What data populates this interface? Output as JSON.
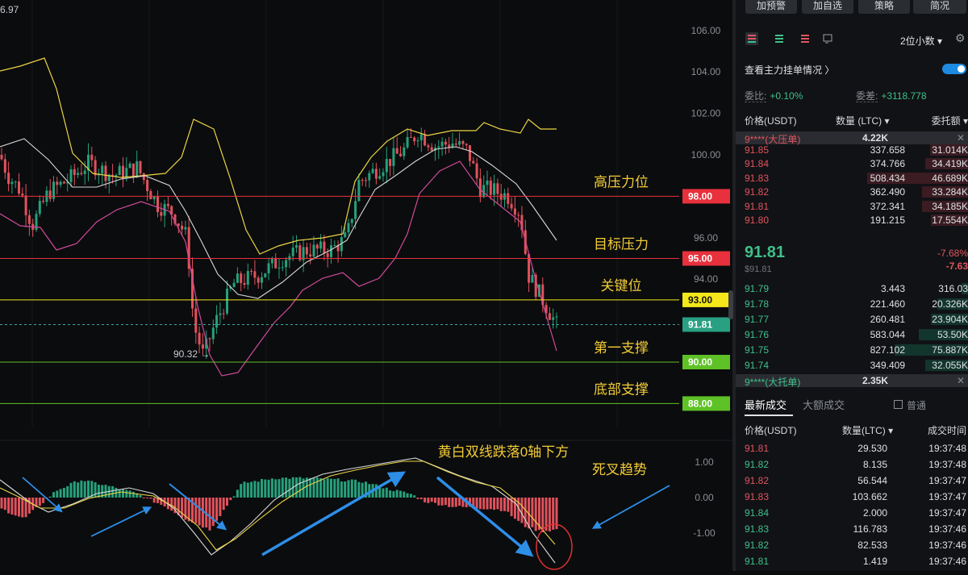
{
  "chart": {
    "price_axis_labels": [
      "106.00",
      "104.00",
      "102.00",
      "100.00",
      "96.00",
      "94.00"
    ],
    "corner_value": "6.97",
    "low_marker": "90.32",
    "levels": [
      {
        "name": "高压力位",
        "price": "98.00",
        "color": "#e8313c",
        "text_color": "#ffffff",
        "line": "#e8313c"
      },
      {
        "name": "目标压力",
        "price": "95.00",
        "color": "#e8313c",
        "text_color": "#ffffff",
        "line": "#e8313c"
      },
      {
        "name": "关键位",
        "price": "93.00",
        "color": "#f4e71a",
        "text_color": "#111111",
        "line": "#f4e71a"
      },
      {
        "name": "",
        "price": "91.81",
        "color": "#29a082",
        "text_color": "#ffffff",
        "line": "#3aa6a0"
      },
      {
        "name": "第一支撑",
        "price": "90.00",
        "color": "#5ec227",
        "text_color": "#ffffff",
        "line": "#5ec227"
      },
      {
        "name": "底部支撑",
        "price": "88.00",
        "color": "#5ec227",
        "text_color": "#ffffff",
        "line": "#5ec227"
      }
    ],
    "macd_axis_labels": [
      "1.00",
      "0.00",
      "-1.00"
    ],
    "annotations": {
      "cross_down": "黄白双线跌落0轴下方",
      "death_cross": "死叉趋势"
    },
    "colors": {
      "up": "#26a17b",
      "down": "#e0525c",
      "yellow": "#ecd545",
      "white": "#d8d8d8",
      "magenta": "#d04a9a",
      "arrow": "#2d8ee8",
      "label": "#f2cc36"
    }
  },
  "panel": {
    "buttons": [
      "加预警",
      "加自选",
      "策略",
      "简况"
    ],
    "decimals": "2位小数 ▾",
    "gear": "⚙",
    "check_label": "查看主力挂单情况",
    "ratio": {
      "k1": "委比:",
      "v1": "+0.10%",
      "k2": "委差:",
      "v2": "+3118.778"
    },
    "ob_headers": {
      "price": "价格(USDT)",
      "qty": "数量 (LTC) ▾",
      "amount": "委托额 ▾"
    },
    "big_ask": {
      "label": "9****(大压单)",
      "qty": "4.22K"
    },
    "asks": [
      {
        "price": "91.85",
        "qty": "337.658",
        "amt": "31.014K",
        "w": 0.25
      },
      {
        "price": "91.84",
        "qty": "374.766",
        "amt": "34.419K",
        "w": 0.28
      },
      {
        "price": "91.83",
        "qty": "508.434",
        "amt": "46.689K",
        "w": 0.66
      },
      {
        "price": "91.82",
        "qty": "362.490",
        "amt": "33.284K",
        "w": 0.3
      },
      {
        "price": "91.81",
        "qty": "372.341",
        "amt": "34.185K",
        "w": 0.3
      },
      {
        "price": "91.80",
        "qty": "191.215",
        "amt": "17.554K",
        "w": 0.24
      }
    ],
    "mid": {
      "price": "91.81",
      "sub": "$91.81",
      "pct": "-7.68%",
      "chg": "-7.63"
    },
    "bids": [
      {
        "price": "91.79",
        "qty": "3.443",
        "amt": "316.03",
        "w": 0.04
      },
      {
        "price": "91.78",
        "qty": "221.460",
        "amt": "20.326K",
        "w": 0.2
      },
      {
        "price": "91.77",
        "qty": "260.481",
        "amt": "23.904K",
        "w": 0.24
      },
      {
        "price": "91.76",
        "qty": "583.044",
        "amt": "53.50K",
        "w": 0.32
      },
      {
        "price": "91.75",
        "qty": "827.102",
        "amt": "75.887K",
        "w": 0.48
      },
      {
        "price": "91.74",
        "qty": "349.409",
        "amt": "32.055K",
        "w": 0.28
      }
    ],
    "big_bid": {
      "label": "9****(大托单)",
      "qty": "2.35K"
    },
    "trade_tabs": {
      "latest": "最新成交",
      "large": "大额成交",
      "normal": "普通"
    },
    "trade_headers": {
      "price": "价格(USDT)",
      "qty": "数量(LTC) ▾",
      "time": "成交时间"
    },
    "trades": [
      {
        "price": "91.81",
        "qty": "29.530",
        "time": "19:37:48",
        "side": "sell"
      },
      {
        "price": "91.82",
        "qty": "8.135",
        "time": "19:37:48",
        "side": "buy"
      },
      {
        "price": "91.82",
        "qty": "56.544",
        "time": "19:37:47",
        "side": "sell"
      },
      {
        "price": "91.83",
        "qty": "103.662",
        "time": "19:37:47",
        "side": "sell"
      },
      {
        "price": "91.84",
        "qty": "2.000",
        "time": "19:37:47",
        "side": "buy"
      },
      {
        "price": "91.83",
        "qty": "116.783",
        "time": "19:37:46",
        "side": "buy"
      },
      {
        "price": "91.82",
        "qty": "82.533",
        "time": "19:37:46",
        "side": "buy"
      },
      {
        "price": "91.81",
        "qty": "1.419",
        "time": "19:37:46",
        "side": "buy"
      }
    ]
  }
}
